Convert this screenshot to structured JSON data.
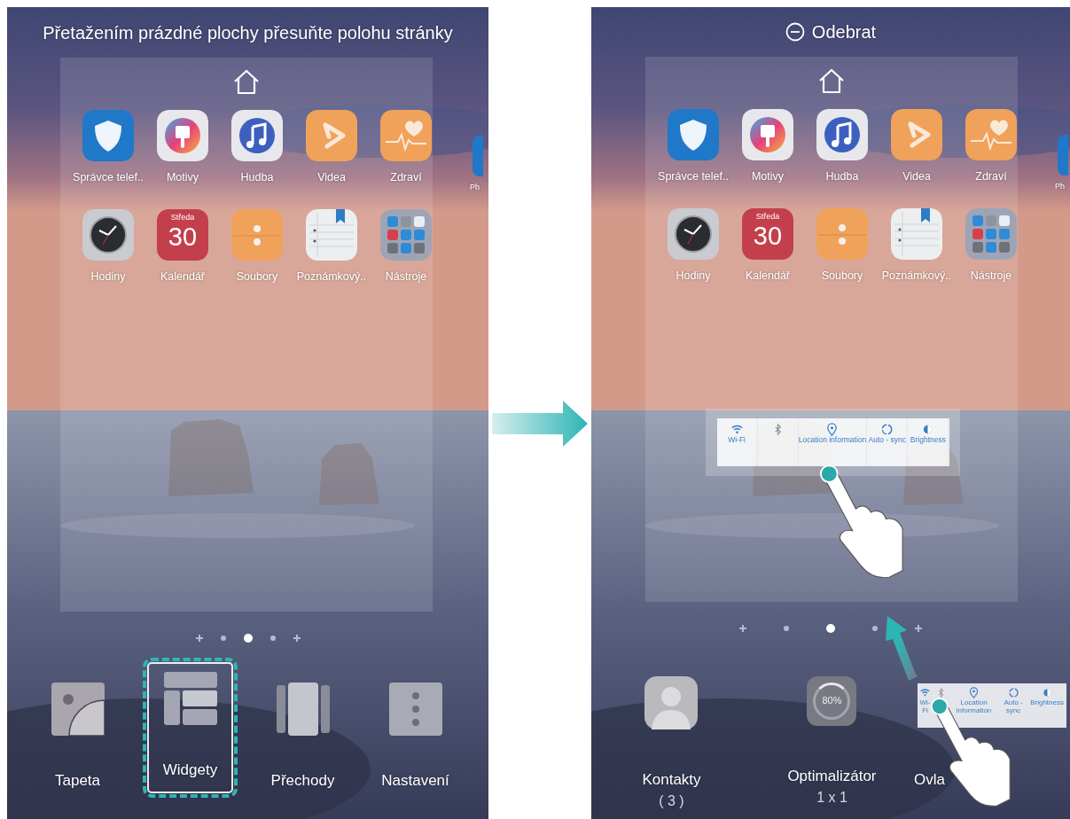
{
  "screens": [
    {
      "header": {
        "kind": "hint",
        "text": "Přetažením prázdné plochy přesuňte polohu stránky"
      },
      "apps": [
        {
          "kind": "shield",
          "label": "Správce telef.."
        },
        {
          "kind": "themes",
          "label": "Motivy"
        },
        {
          "kind": "music",
          "label": "Hudba"
        },
        {
          "kind": "video",
          "label": "Videa"
        },
        {
          "kind": "health",
          "label": "Zdraví"
        },
        {
          "kind": "clock",
          "label": "Hodiny"
        },
        {
          "kind": "calendar",
          "label": "Kalendář",
          "day": "Středa",
          "date": "30"
        },
        {
          "kind": "files",
          "label": "Soubory"
        },
        {
          "kind": "notes",
          "label": "Poznámkový.."
        },
        {
          "kind": "folder",
          "label": "Nástroje"
        }
      ],
      "side_label": "Ph",
      "page_dots": [
        {
          "kind": "plus",
          "selected": false
        },
        {
          "kind": "dot",
          "selected": false
        },
        {
          "kind": "dot",
          "selected": true
        },
        {
          "kind": "dot",
          "selected": false
        },
        {
          "kind": "plus",
          "selected": false
        }
      ],
      "menu": [
        {
          "kind": "wallpaper",
          "label": "Tapeta",
          "highlighted": false
        },
        {
          "kind": "widgets",
          "label": "Widgety",
          "highlighted": true
        },
        {
          "kind": "transitions",
          "label": "Přechody",
          "highlighted": false
        },
        {
          "kind": "settings",
          "label": "Nastavení",
          "highlighted": false
        }
      ]
    },
    {
      "header": {
        "kind": "remove",
        "text": "Odebrat"
      },
      "apps": [
        {
          "kind": "shield",
          "label": "Správce telef.."
        },
        {
          "kind": "themes",
          "label": "Motivy"
        },
        {
          "kind": "music",
          "label": "Hudba"
        },
        {
          "kind": "video",
          "label": "Videa"
        },
        {
          "kind": "health",
          "label": "Zdraví"
        },
        {
          "kind": "clock",
          "label": "Hodiny"
        },
        {
          "kind": "calendar",
          "label": "Kalendář",
          "day": "Středa",
          "date": "30"
        },
        {
          "kind": "files",
          "label": "Soubory"
        },
        {
          "kind": "notes",
          "label": "Poznámkový.."
        },
        {
          "kind": "folder",
          "label": "Nástroje"
        }
      ],
      "side_label": "Ph",
      "widget": {
        "tiles": [
          {
            "kind": "wifi",
            "label": "Wi-Fi"
          },
          {
            "kind": "bluetooth"
          },
          {
            "kind": "location",
            "label": "Location information"
          },
          {
            "kind": "sync",
            "label": "Auto - sync"
          },
          {
            "kind": "brightness",
            "label": "Brightness"
          }
        ]
      },
      "page_dots": [
        {
          "kind": "plus",
          "selected": false
        },
        {
          "kind": "dot",
          "selected": false
        },
        {
          "kind": "dot",
          "selected": true
        },
        {
          "kind": "dot",
          "selected": false
        },
        {
          "kind": "plus",
          "selected": false
        }
      ],
      "menu": [
        {
          "kind": "contact",
          "label": "Kontakty",
          "sub": "( 3 )"
        },
        {
          "kind": "optimizer",
          "label": "Optimalizátor",
          "sub": "1 x 1",
          "badge": "80%"
        },
        {
          "kind": "quick-settings",
          "label": "Ovla",
          "tiles": [
            {
              "kind": "wifi",
              "label": "Wi-Fi"
            },
            {
              "kind": "bluetooth"
            },
            {
              "kind": "location",
              "label": "Location information"
            },
            {
              "kind": "sync",
              "label": "Auto - sync"
            },
            {
              "kind": "brightness",
              "label": "Brightness"
            }
          ]
        }
      ]
    }
  ]
}
